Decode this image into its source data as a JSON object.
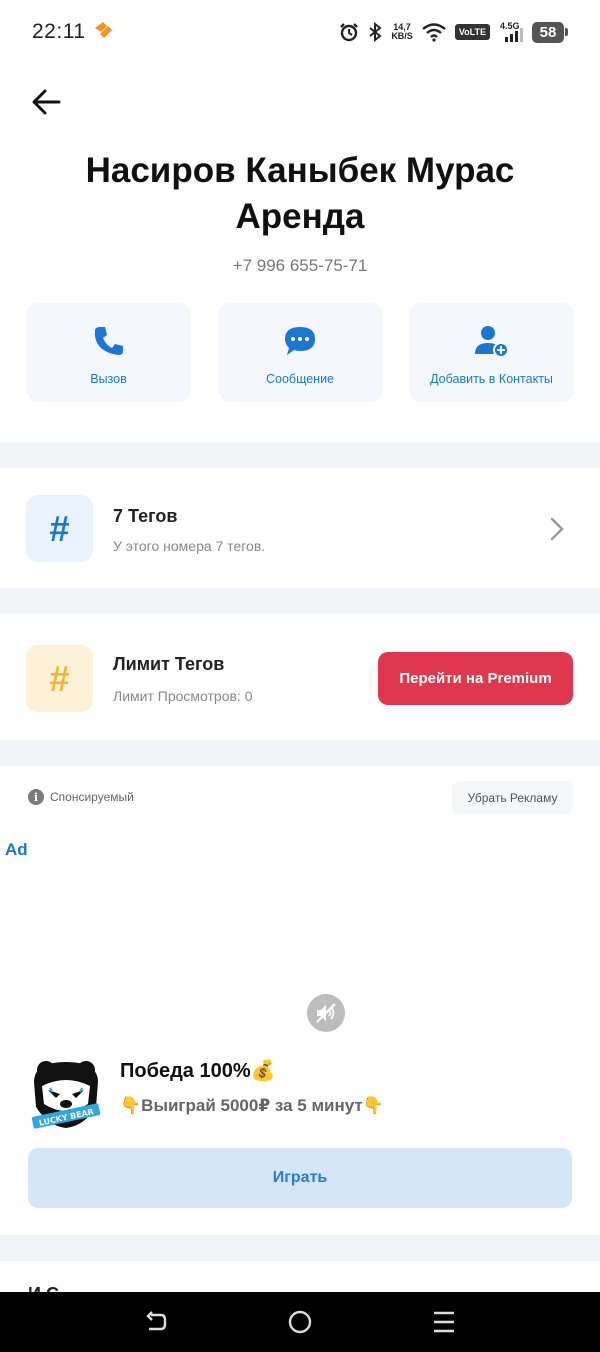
{
  "status_bar": {
    "time": "22:11",
    "net_speed_value": "14,7",
    "net_speed_unit": "KB/S",
    "volte": "VoLTE",
    "network_type": "4.5G",
    "battery": "58"
  },
  "contact": {
    "name_line1": "Насиров Каныбек Мурас",
    "name_line2": "Аренда",
    "phone": "+7 996 655-75-71"
  },
  "actions": [
    {
      "label": "Вызов",
      "icon": "phone-icon"
    },
    {
      "label": "Сообщение",
      "icon": "chat-bubble-icon"
    },
    {
      "label": "Добавить в Контакты",
      "icon": "add-person-icon"
    }
  ],
  "tags": {
    "icon": "#",
    "title": "7 Тегов",
    "subtitle": "У этого номера 7 тегов."
  },
  "limit": {
    "icon": "#",
    "title": "Лимит Тегов",
    "subtitle": "Лимит Просмотров: 0",
    "premium_button": "Перейти на Premium"
  },
  "ad": {
    "sponsored_label": "Спонсируемый",
    "remove_ads_button": "Убрать Рекламу",
    "ad_tag": "Ad",
    "logo_text": "LUCKY BEAR",
    "headline": "Победа 100%💰",
    "body": "👇Выиграй 5000₽ за 5 минут👇",
    "cta": "Играть"
  },
  "peek_text": "И        С",
  "colors": {
    "accent_blue": "#1a78d4",
    "premium_red": "#e0374e",
    "tag_tile_blue_bg": "#eaf2fd",
    "limit_tile_yellow_bg": "#fdf1d8",
    "limit_icon_yellow": "#f2b43a"
  }
}
